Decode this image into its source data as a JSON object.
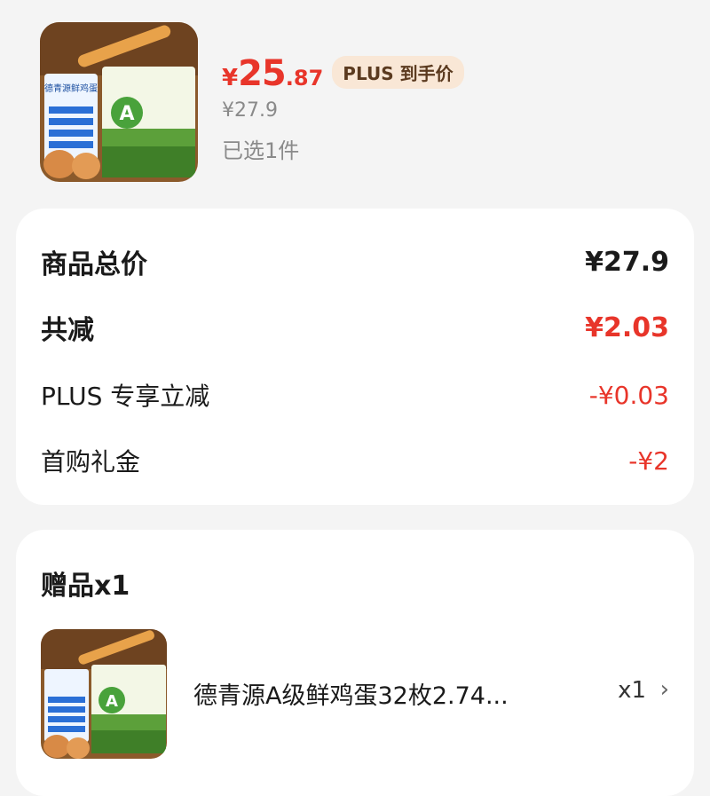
{
  "product": {
    "price_symbol": "¥",
    "price_int": "25",
    "price_dec": ".87",
    "plus_tag": "PLUS 到手价",
    "original_price": "¥27.9",
    "selected_count": "已选1件",
    "image_text": "德青源鲜鸡蛋"
  },
  "summary": {
    "rows": [
      {
        "label": "商品总价",
        "value": "¥27.9"
      },
      {
        "label": "共减",
        "value": "¥2.03"
      },
      {
        "label": "PLUS 专享立减",
        "value": "-¥0.03"
      },
      {
        "label": "首购礼金",
        "value": "-¥2"
      }
    ]
  },
  "gift": {
    "title": "赠品x1",
    "item_name": "德青源A级鲜鸡蛋32枚2.74...",
    "quantity": "x1"
  },
  "colors": {
    "accent_red": "#e8352a",
    "plus_tag_bg": "#f9e7d6",
    "page_bg": "#f4f4f4"
  }
}
